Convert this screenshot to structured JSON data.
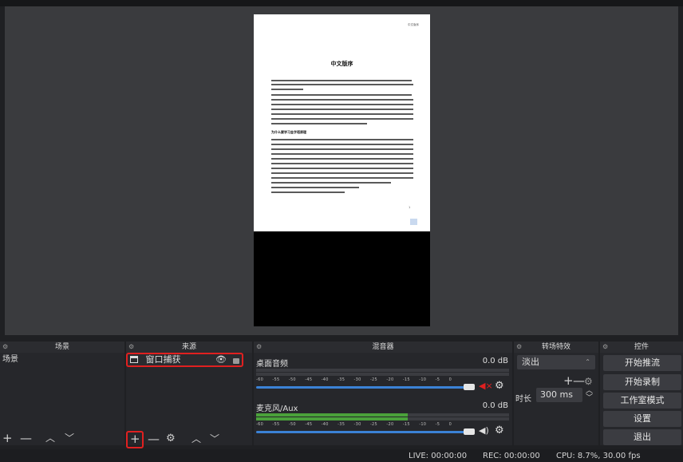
{
  "doc": {
    "header_right": "中文版序",
    "title": "中文版序",
    "section_heading": "为什么要学习金字塔原理",
    "page_number": "1"
  },
  "docks": {
    "scenes": {
      "title": "场景",
      "items": [
        "场景"
      ]
    },
    "sources": {
      "title": "来源",
      "items": [
        {
          "label": "窗口捕获"
        }
      ]
    },
    "mixer": {
      "title": "混音器",
      "channels": [
        {
          "name": "桌面音频",
          "level": "0.0 dB",
          "muted": true,
          "meter_fill": 0
        },
        {
          "name": "麦克风/Aux",
          "level": "0.0 dB",
          "muted": false,
          "meter_fill": 0.6
        }
      ],
      "ticks": [
        "-60",
        "-55",
        "-50",
        "-45",
        "-40",
        "-35",
        "-30",
        "-25",
        "-20",
        "-15",
        "-10",
        "-5",
        "0"
      ]
    },
    "transitions": {
      "title": "转场特效",
      "selected": "淡出",
      "duration_label": "时长",
      "duration_value": "300 ms"
    },
    "controls": {
      "title": "控件",
      "buttons": [
        "开始推流",
        "开始录制",
        "工作室模式",
        "设置",
        "退出"
      ]
    }
  },
  "status": {
    "live": "LIVE: 00:00:00",
    "rec": "REC: 00:00:00",
    "cpu": "CPU: 8.7%, 30.00 fps"
  },
  "colors": {
    "highlight": "#e02020",
    "meter_green": "#4aa13a",
    "slider_blue": "#3b82d6",
    "mute_red": "#e02020"
  }
}
